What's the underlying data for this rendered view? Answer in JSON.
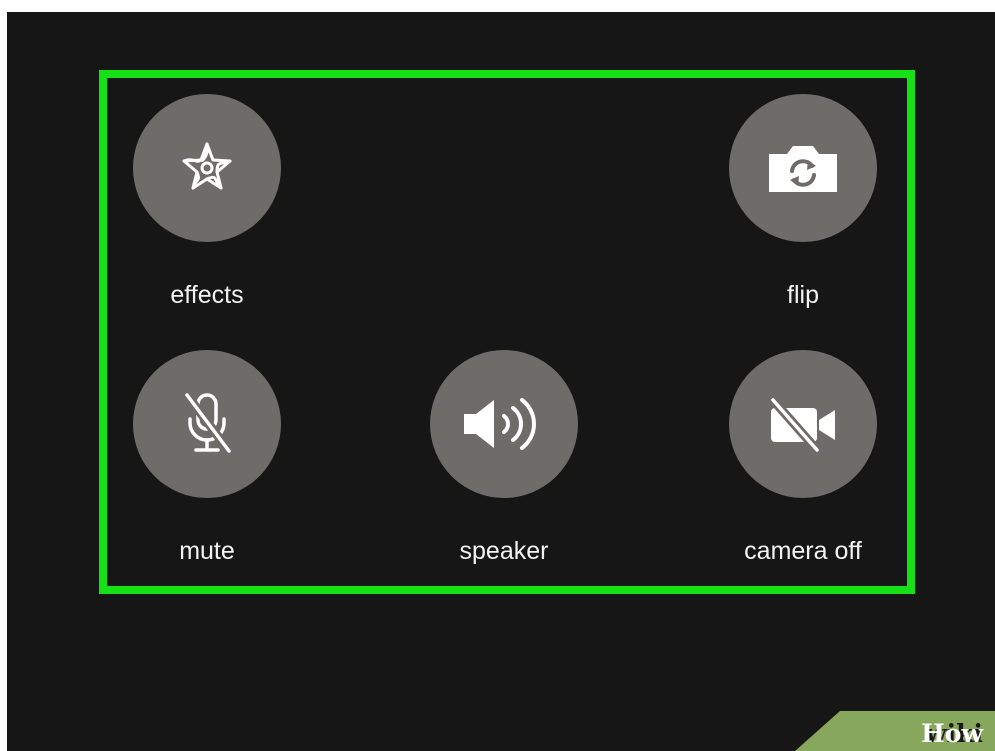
{
  "controls": {
    "effects": {
      "label": "effects",
      "icon": "effects-star-icon"
    },
    "flip": {
      "label": "flip",
      "icon": "camera-flip-icon"
    },
    "mute": {
      "label": "mute",
      "icon": "microphone-muted-icon"
    },
    "speaker": {
      "label": "speaker",
      "icon": "speaker-volume-icon"
    },
    "camera_off": {
      "label": "camera off",
      "icon": "video-camera-off-icon"
    }
  },
  "colors": {
    "background": "#161616",
    "button": "#6e6c69",
    "highlight_border": "#16e016",
    "label_text": "#f2f2f2",
    "watermark_bg": "#87a75d"
  },
  "watermark": {
    "part1": "wiki",
    "part2": "How"
  }
}
